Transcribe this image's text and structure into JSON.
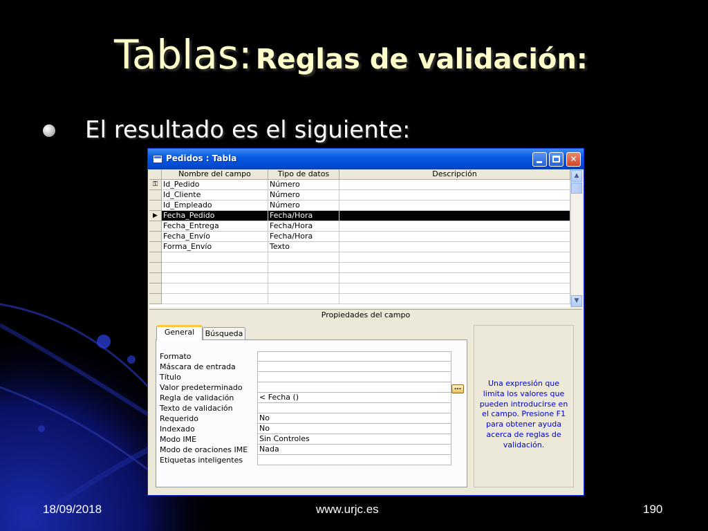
{
  "slide": {
    "title_main": "Tablas:",
    "title_sub": "Reglas de validación:",
    "bullet": "El resultado es el siguiente:",
    "footer_date": "18/09/2018",
    "footer_url": "www.urjc.es",
    "footer_page": "190"
  },
  "window": {
    "title": "Pedidos : Tabla",
    "buttons": {
      "minimize": "minimize",
      "maximize": "maximize",
      "close": "✕"
    },
    "grid": {
      "headers": [
        "Nombre del campo",
        "Tipo de datos",
        "Descripción"
      ],
      "rows": [
        {
          "name": "Id_Pedido",
          "type": "Número",
          "desc": "",
          "marker": "key-icon"
        },
        {
          "name": "Id_Cliente",
          "type": "Número",
          "desc": ""
        },
        {
          "name": "Id_Empleado",
          "type": "Número",
          "desc": ""
        },
        {
          "name": "Fecha_Pedido",
          "type": "Fecha/Hora",
          "desc": "",
          "marker": "current-row-arrow-icon",
          "current": true
        },
        {
          "name": "Fecha_Entrega",
          "type": "Fecha/Hora",
          "desc": ""
        },
        {
          "name": "Fecha_Envío",
          "type": "Fecha/Hora",
          "desc": ""
        },
        {
          "name": "Forma_Envío",
          "type": "Texto",
          "desc": ""
        }
      ],
      "empty_rows": 5
    },
    "properties_label": "Propiedades del campo",
    "tabs": [
      "General",
      "Búsqueda"
    ],
    "active_tab": "General",
    "properties": [
      {
        "label": "Formato",
        "value": ""
      },
      {
        "label": "Máscara de entrada",
        "value": ""
      },
      {
        "label": "Título",
        "value": ""
      },
      {
        "label": "Valor predeterminado",
        "value": ""
      },
      {
        "label": "Regla de validación",
        "value": "< Fecha ()"
      },
      {
        "label": "Texto de validación",
        "value": ""
      },
      {
        "label": "Requerido",
        "value": "No"
      },
      {
        "label": "Indexado",
        "value": "No"
      },
      {
        "label": "Modo IME",
        "value": "Sin Controles"
      },
      {
        "label": "Modo de oraciones IME",
        "value": "Nada"
      },
      {
        "label": "Etiquetas inteligentes",
        "value": ""
      }
    ],
    "build_button": "...",
    "help_text": "Una expresión que limita los valores que pueden introducirse en el campo. Presione F1 para obtener ayuda acerca de reglas de validación."
  },
  "colors": {
    "title": "#ffffcc",
    "titlebar": "#0a5be0",
    "help_text": "#0000cc",
    "slide_background": "#000000"
  }
}
